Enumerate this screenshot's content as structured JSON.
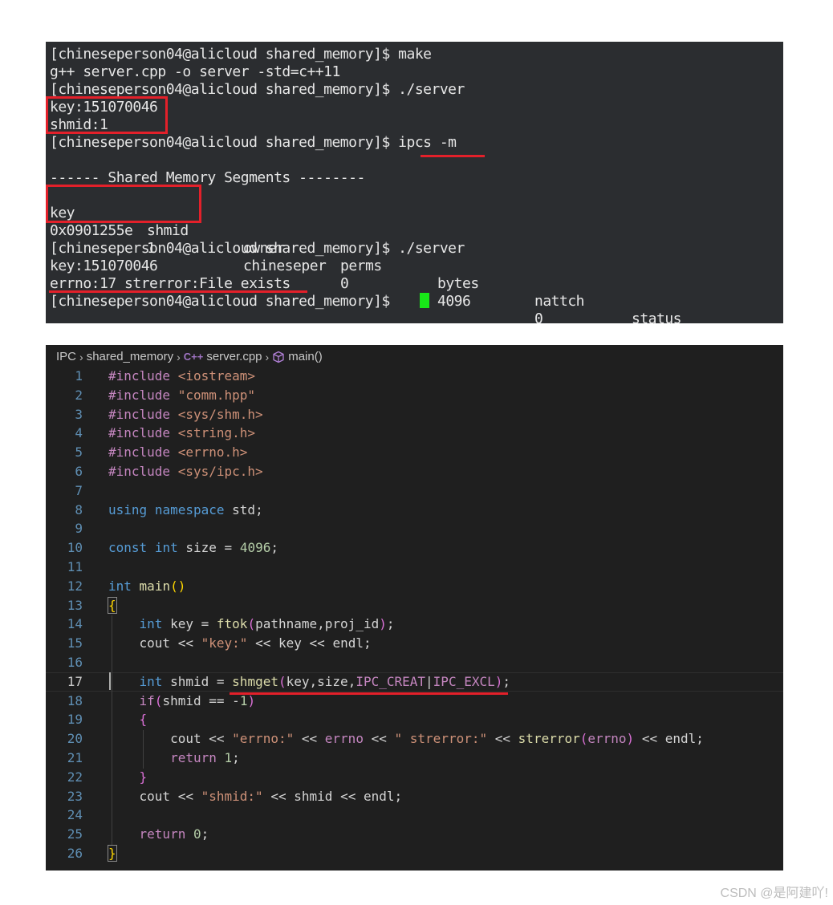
{
  "terminal": {
    "lines": [
      "[chineseperson04@alicloud shared_memory]$ make",
      "g++ server.cpp -o server -std=c++11",
      "[chineseperson04@alicloud shared_memory]$ ./server",
      "key:151070046",
      "shmid:1",
      "[chineseperson04@alicloud shared_memory]$ ipcs -m",
      "",
      "------ Shared Memory Segments --------",
      "",
      "",
      "",
      "[chineseperson04@alicloud shared_memory]$ ./server",
      "key:151070046",
      "errno:17 strerror:File exists",
      "[chineseperson04@alicloud shared_memory]$ "
    ],
    "table_headers": [
      "key",
      "shmid",
      "owner",
      "perms",
      "bytes",
      "nattch",
      "status"
    ],
    "table_row": [
      "0x0901255e",
      "1",
      "chineseper",
      "0",
      "4096",
      "0",
      ""
    ]
  },
  "editor": {
    "breadcrumb": [
      "IPC",
      "shared_memory",
      "server.cpp",
      "main()"
    ],
    "cpp_icon_label": "C++",
    "code": [
      "#include <iostream>",
      "#include \"comm.hpp\"",
      "#include <sys/shm.h>",
      "#include <string.h>",
      "#include <errno.h>",
      "#include <sys/ipc.h>",
      "",
      "using namespace std;",
      "",
      "const int size = 4096;",
      "",
      "int main()",
      "{",
      "    int key = ftok(pathname,proj_id);",
      "    cout << \"key:\" << key << endl;",
      "",
      "    int shmid = shmget(key,size,IPC_CREAT|IPC_EXCL);",
      "    if(shmid == -1)",
      "    {",
      "        cout << \"errno:\" << errno << \" strerror:\" << strerror(errno) << endl;",
      "        return 1;",
      "    }",
      "    cout << \"shmid:\" << shmid << endl;",
      "",
      "    return 0;",
      "}"
    ]
  },
  "watermark": "CSDN @是阿建吖!"
}
